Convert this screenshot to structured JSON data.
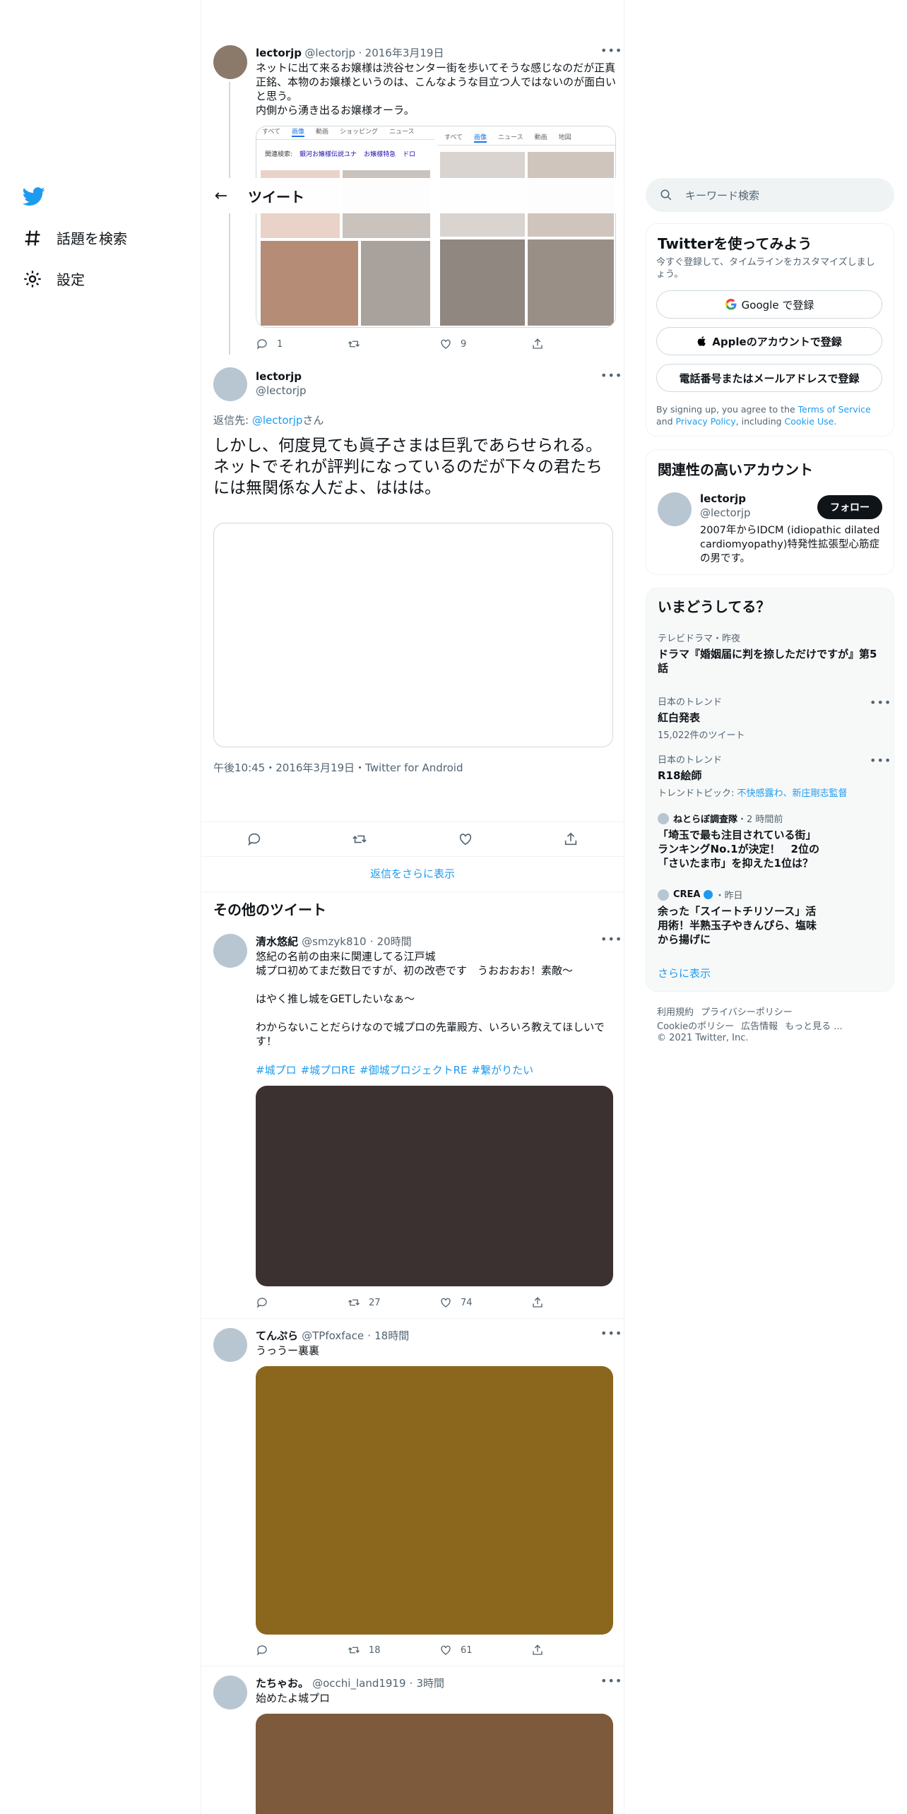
{
  "nav": {
    "explore_label": "話題を検索",
    "settings_label": "設定"
  },
  "header": {
    "title": "ツイート"
  },
  "parent_tweet": {
    "name": "lectorjp",
    "handle": "@lectorjp",
    "date": "2016年3月19日",
    "text": "ネットに出て来るお嬢様は渋谷センター街を歩いてそうな感じなのだが正真正銘、本物のお嬢様というのは、こんなような目立つ人ではないのが面白いと思う。\n内側から湧き出るお嬢様オーラ。",
    "reply_count": "1",
    "retweet_count": "",
    "like_count": "9",
    "screenshot_left": {
      "tabs": [
        "すべて",
        "画像",
        "動画",
        "ショッピング",
        "ニュース"
      ],
      "related_label": "関連検索:",
      "related_items": [
        "銀河お嬢様伝説ユナ",
        "お嬢様特急",
        "ドロ"
      ]
    },
    "screenshot_right": {
      "tabs": [
        "すべて",
        "画像",
        "ニュース",
        "動画",
        "地図"
      ]
    }
  },
  "main_tweet": {
    "name": "lectorjp",
    "handle": "@lectorjp",
    "reply_prefix": "返信先: ",
    "reply_to": "@lectorjp",
    "reply_suffix": "さん",
    "text": "しかし、何度見ても眞子さまは巨乳であらせられる。\nネットでそれが評判になっているのだが下々の君たちには無関係な人だよ、ははは。",
    "timestamp": "午後10:45・2016年3月19日・Twitter for Android"
  },
  "show_more_replies": "返信をさらに表示",
  "more_tweets_title": "その他のツイート",
  "more_tweets": [
    {
      "name": "清水悠紀",
      "handle": "@smzyk810",
      "time": "20時間",
      "text": "悠紀の名前の由来に関連してる江戸城\n城プロ初めてまだ数日ですが、初の改壱です　うおおおお！素敵〜\n\nはやく推し城をGETしたいなぁ〜\n\nわからないことだらけなので城プロの先輩殿方、いろいろ教えてほしいです！",
      "hashtags": [
        "#城プロ",
        "#城プロRE",
        "#御城プロジェクトRE",
        "#繋がりたい"
      ],
      "media_color": "#3b3130",
      "reply_count": "",
      "retweet_count": "27",
      "like_count": "74"
    },
    {
      "name": "てんぷら",
      "handle": "@TPfoxface",
      "time": "18時間",
      "text": "うっうー裏裏",
      "media_color": "#8b661d",
      "reply_count": "",
      "retweet_count": "18",
      "like_count": "61"
    },
    {
      "name": "たちゃお。",
      "handle": "@occhi_land1919",
      "time": "3時間",
      "text": "始めたよ城プロ",
      "media_color": "#7d5a3c"
    }
  ],
  "search": {
    "placeholder": "キーワード検索"
  },
  "signup_panel": {
    "title": "Twitterを使ってみよう",
    "subtitle": "今すぐ登録して、タイムラインをカスタマイズしましょう。",
    "google_btn": "Google で登録",
    "apple_btn": "Appleのアカウントで登録",
    "phone_btn": "電話番号またはメールアドレスで登録",
    "legal_prefix": "By signing up, you agree to the ",
    "terms": "Terms of Service",
    "and": " and ",
    "privacy": "Privacy Policy",
    "including": ", including ",
    "cookie": "Cookie Use",
    "period": "."
  },
  "relevant_panel": {
    "title": "関連性の高いアカウント",
    "name": "lectorjp",
    "handle": "@lectorjp",
    "follow_btn": "フォロー",
    "bio": "2007年からIDCM (idiopathic dilated cardiomyopathy)特発性拡張型心筋症の男です。"
  },
  "trends_panel": {
    "title": "いまどうしてる？",
    "items": [
      {
        "context": "テレビドラマ・昨夜",
        "title": "ドラマ『婚姻届に判を捺しただけですが』第5話",
        "sub": ""
      },
      {
        "context": "日本のトレンド",
        "title": "紅白発表",
        "sub": "15,022件のツイート"
      },
      {
        "context": "日本のトレンド",
        "title": "R18絵師",
        "sub_prefix": "トレンドトピック: ",
        "sub_link": "不快感露わ、新庄剛志監督"
      },
      {
        "context_name": "ねとらぼ調査隊",
        "context_time": "・2 時間前",
        "title": "「埼玉で最も注目されている街」ランキングNo.1が決定！　2位の「さいたま市」を抑えた1位は？"
      },
      {
        "context_name": "CREA",
        "context_time": "・昨日",
        "title": "余った「スイートチリソース」活用術！半熟玉子やきんぴら、塩味から揚げに"
      }
    ],
    "show_more": "さらに表示"
  },
  "footer": {
    "line1": [
      "利用規約",
      "プライバシーポリシー"
    ],
    "line2": [
      "Cookieのポリシー",
      "広告情報",
      "もっと見る ..."
    ],
    "copyright": "© 2021 Twitter, Inc."
  },
  "colors": {
    "accent": "#1d9bf0",
    "text": "#0f1419",
    "muted": "#536471"
  }
}
